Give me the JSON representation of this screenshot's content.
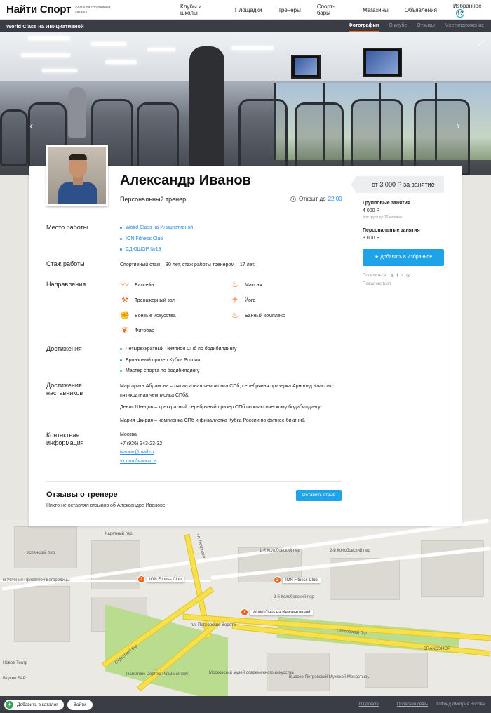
{
  "header": {
    "logo": "Найти Спорт",
    "logo_subtitle": "Большой спортивный каталог",
    "nav": [
      "Клубы и школы",
      "Площадки",
      "Тренеры",
      "Спорт-бары",
      "Магазины",
      "Объявления",
      "Избранное"
    ],
    "favorites_count": "12"
  },
  "subbar": {
    "title": "World Class на Инициативной",
    "tabs": [
      "Фотографии",
      "О клубе",
      "Отзывы",
      "Местоположение"
    ],
    "active_tab": "Фотографии"
  },
  "trainer": {
    "name": "Александр Иванов",
    "role": "Персональный тренер",
    "open_label": "Открыт до",
    "open_time": "22:00"
  },
  "sections": {
    "workplace_label": "Место работы",
    "workplaces": [
      "Wolrd Class на Инициативной",
      "ION Fitness Club",
      "СДЮШОР №19"
    ],
    "experience_label": "Стаж работы",
    "experience": "Спортивный стаж – 30 лет, стаж работы тренером – 17 лет.",
    "directions_label": "Направления",
    "directions": [
      {
        "label": "Бассейн",
        "icon": "pool-icon"
      },
      {
        "label": "Массаж",
        "icon": "massage-icon"
      },
      {
        "label": "Тренажерный зал",
        "icon": "gym-icon"
      },
      {
        "label": "Йога",
        "icon": "yoga-icon"
      },
      {
        "label": "Боевые искусства",
        "icon": "martial-arts-icon"
      },
      {
        "label": "Банный комплекс",
        "icon": "sauna-icon"
      },
      {
        "label": "Фитобар",
        "icon": "phytobar-icon"
      }
    ],
    "achievements_label": "Достижения",
    "achievements": [
      "Четырехкратный Чемпион СПб по бодибилдингу",
      "Бронзовый призер Кубка России",
      "Мастер спорта по бодибилдингу"
    ],
    "mentor_label_1": "Достижения",
    "mentor_label_2": "наставников",
    "mentor_achievements": [
      "Маргарита Абрамова – пятикратная чемпионка СПб, серебряная призерка Арнольд Классик, пятикратная чемпионка СПб&",
      "Денис Швецов – трехкратный серебряный призер СПб по классическому бодибилдингу",
      "Мария Цкирия – чемпионка СПб и финалистка Кубка России по фитнес-бикини&"
    ],
    "contact_label_1": "Контактная",
    "contact_label_2": "информация",
    "city": "Москва",
    "phone": "+7 (926) 343-23-32",
    "email": "ivanov@mail.ru",
    "vk": "vk.com/ivanov_a"
  },
  "reviews": {
    "title": "Отзывы о тренере",
    "empty": "Никто не оставлял отзывов об Александре Иванове.",
    "button": "Оставить отзыв"
  },
  "sidebar": {
    "price": "от 3 000 Р за занятие",
    "group_label": "Групповые занятия",
    "group_price": "4 000 Р",
    "group_note": "для групп до 10 человек",
    "personal_label": "Персональные занятия",
    "personal_price": "3 000 Р",
    "fav_button": "★ Добавить в Избранное",
    "share_label": "Поделиться:",
    "share_icons": [
      "vk-icon",
      "facebook-icon",
      "twitter-icon",
      "mail-icon"
    ],
    "complain": "Пожаловаться"
  },
  "map": {
    "labels": [
      "Успенский пер",
      "Каретный пер",
      "1-й Колобовский пер",
      "2-й Колобовский пер",
      "2-й Колобовский пер",
      "ул. Петровка",
      "пл. Петровские Ворота",
      "Петровский б-р",
      "Страстной б-р",
      "Памятник Сергею Рахманинову",
      "Московский музей современного искусства",
      "Высоко-Петровский Мужской Монастырь",
      "BRANDSHOP",
      "м Успения Пресвятой Богородицы",
      "Новое Театр",
      "Вкусно БАР"
    ],
    "pins": [
      {
        "num": "1",
        "label": "World Class на Инициативной"
      },
      {
        "num": "2",
        "label": "ION Fitness Club"
      },
      {
        "num": "3",
        "label": "ION Fitness Club"
      }
    ]
  },
  "footer": {
    "add_catalog": "Добавить в каталог",
    "login": "Войти",
    "about": "О проекте",
    "feedback": "Обратная связь",
    "copyright": "© Фонд Дмитрия Носова"
  },
  "colors": {
    "accent": "#f0661e",
    "link": "#2a8be0",
    "button": "#1ea3e8",
    "bar": "#3a3d43"
  }
}
